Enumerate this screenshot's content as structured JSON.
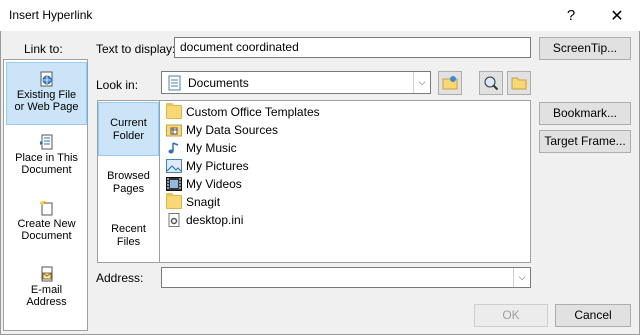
{
  "window": {
    "title": "Insert Hyperlink",
    "help": "?",
    "close": "✕"
  },
  "link_to": {
    "label": "Link to:",
    "items": [
      {
        "line1": "Existing File",
        "line2": "or Web Page",
        "icon": "globe-file-icon",
        "active": true
      },
      {
        "line1": "Place in This",
        "line2": "Document",
        "icon": "document-place-icon"
      },
      {
        "line1": "Create New",
        "line2": "Document",
        "icon": "new-document-icon"
      },
      {
        "line1": "E-mail",
        "line2": "Address",
        "icon": "email-icon"
      }
    ]
  },
  "text_to_display": {
    "label": "Text to display:",
    "value": "document coordinated"
  },
  "screentip_button": "ScreenTip...",
  "look_in": {
    "label": "Look in:",
    "value": "Documents"
  },
  "nav": [
    {
      "line1": "Current",
      "line2": "Folder",
      "active": true
    },
    {
      "line1": "Browsed",
      "line2": "Pages"
    },
    {
      "line1": "Recent",
      "line2": "Files"
    }
  ],
  "files": [
    {
      "name": "Custom Office Templates",
      "icon": "folder-icon"
    },
    {
      "name": "My Data Sources",
      "icon": "data-sources-folder-icon"
    },
    {
      "name": "My Music",
      "icon": "music-folder-icon"
    },
    {
      "name": "My Pictures",
      "icon": "pictures-folder-icon"
    },
    {
      "name": "My Videos",
      "icon": "videos-folder-icon"
    },
    {
      "name": "Snagit",
      "icon": "folder-icon"
    },
    {
      "name": "desktop.ini",
      "icon": "settings-file-icon"
    }
  ],
  "bookmark_button": "Bookmark...",
  "target_frame_button": "Target Frame...",
  "address": {
    "label": "Address:",
    "value": ""
  },
  "ok_button": "OK",
  "cancel_button": "Cancel"
}
